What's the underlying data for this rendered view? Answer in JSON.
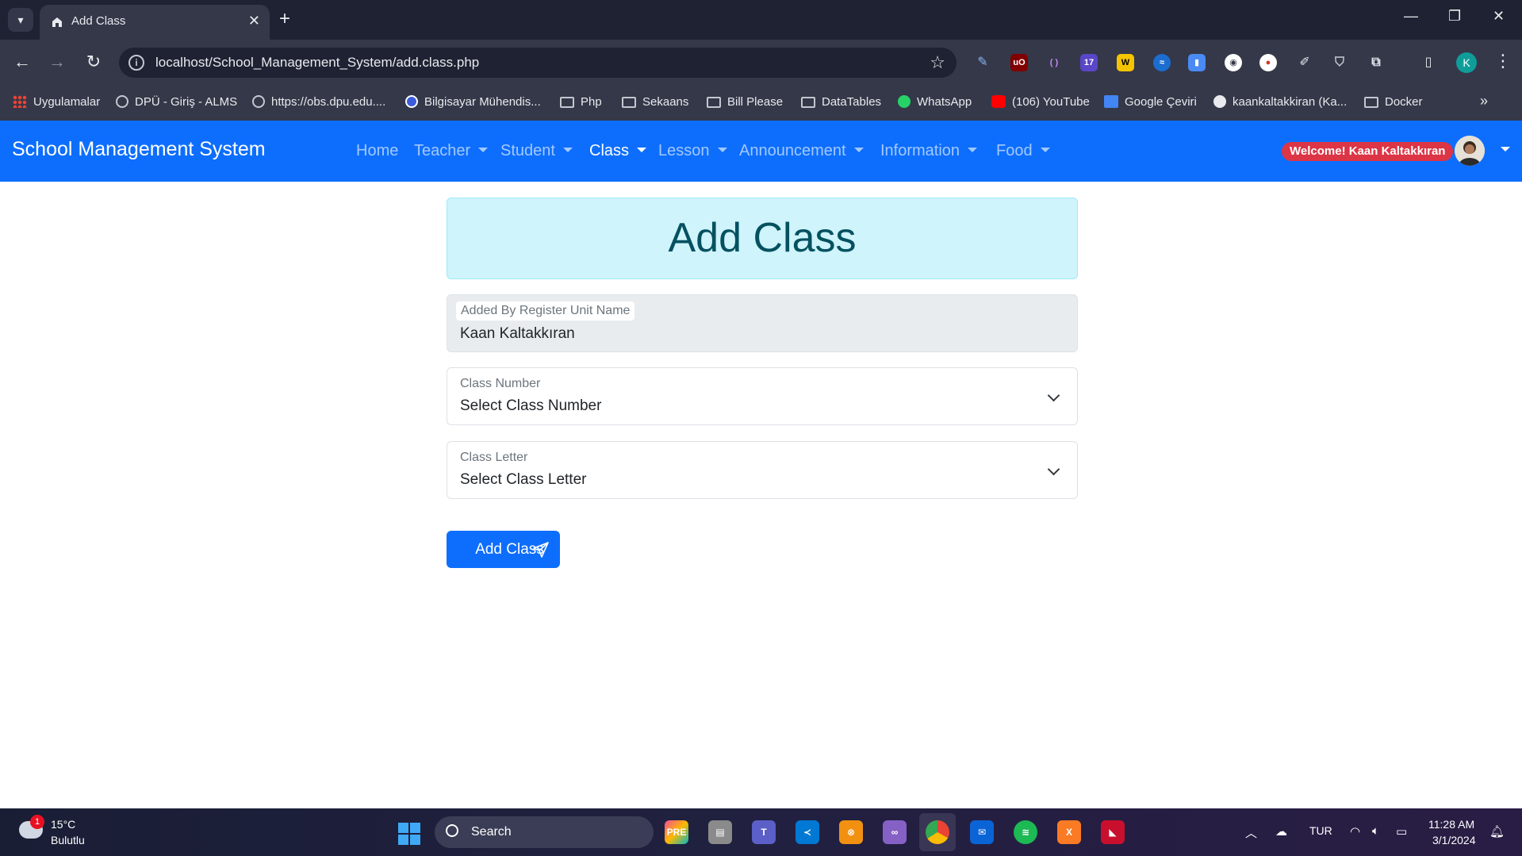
{
  "browser": {
    "tab_title": "Add Class",
    "url": "localhost/School_Management_System/add.class.php",
    "bookmarks": [
      "Uygulamalar",
      "DPÜ - Giriş - ALMS",
      "https://obs.dpu.edu....",
      "Bilgisayar Mühendis...",
      "Php",
      "Sekaans",
      "Bill Please",
      "DataTables",
      "WhatsApp",
      "(106) YouTube",
      "Google Çeviri",
      "kaankaltakkiran (Ka...",
      "Docker"
    ],
    "profile_initial": "K",
    "ext_badge": "17"
  },
  "navbar": {
    "brand": "School Management System",
    "items": [
      "Home",
      "Teacher",
      "Student",
      "Class",
      "Lesson",
      "Announcement",
      "Information",
      "Food"
    ],
    "active": "Class",
    "welcome": "Welcome! Kaan Kaltakkıran"
  },
  "form": {
    "title": "Add Class",
    "added_by_label": "Added By Register Unit Name",
    "added_by_value": "Kaan Kaltakkıran",
    "class_number_label": "Class Number",
    "class_number_value": "Select Class Number",
    "class_letter_label": "Class Letter",
    "class_letter_value": "Select Class Letter",
    "submit_label": "Add Class"
  },
  "taskbar": {
    "weather_temp": "15°C",
    "weather_cond": "Bulutlu",
    "weather_badge": "1",
    "search_label": "Search",
    "language": "TUR",
    "time": "11:28 AM",
    "date": "3/1/2024"
  },
  "colors": {
    "navbar": "#0d6efd",
    "alert_bg": "#cff4fc",
    "alert_text": "#055160",
    "badge": "#dc3545"
  }
}
